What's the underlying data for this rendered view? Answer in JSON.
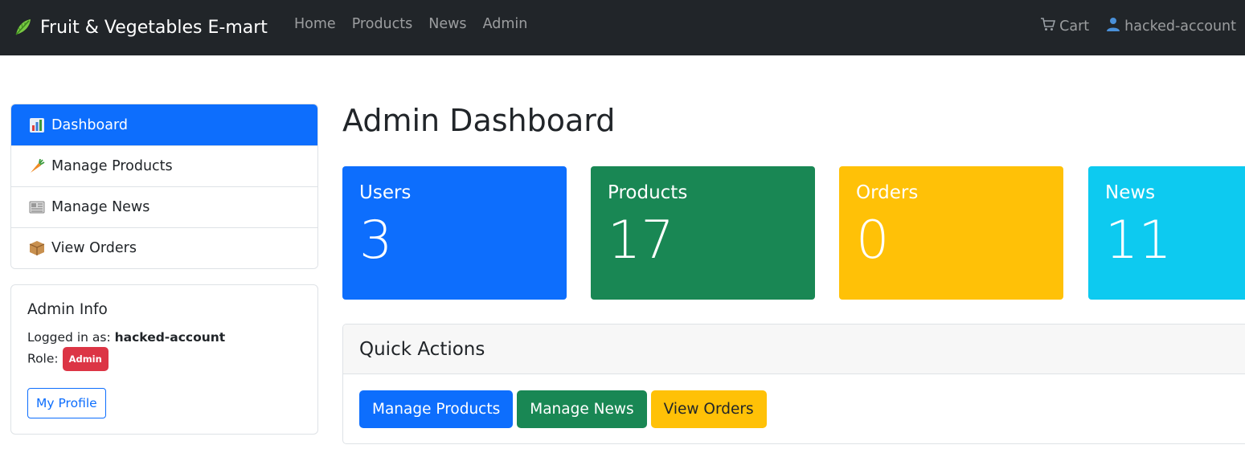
{
  "navbar": {
    "brand": "Fruit & Vegetables E-mart",
    "brand_icon": "lettuce-icon",
    "links": [
      "Home",
      "Products",
      "News",
      "Admin"
    ],
    "cart": "Cart",
    "user": "hacked-account"
  },
  "sidebar": {
    "items": [
      {
        "label": "Dashboard",
        "icon": "bar-chart-icon",
        "active": true
      },
      {
        "label": "Manage Products",
        "icon": "carrot-icon"
      },
      {
        "label": "Manage News",
        "icon": "newspaper-icon"
      },
      {
        "label": "View Orders",
        "icon": "package-icon"
      }
    ],
    "admin_info": {
      "title": "Admin Info",
      "logged_in_label": "Logged in as:",
      "username": "hacked-account",
      "role_label": "Role:",
      "role": "Admin",
      "profile_button": "My Profile"
    }
  },
  "main": {
    "title": "Admin Dashboard",
    "stats": [
      {
        "label": "Users",
        "value": "3",
        "color": "#0d6efd"
      },
      {
        "label": "Products",
        "value": "17",
        "color": "#198754"
      },
      {
        "label": "Orders",
        "value": "0",
        "color": "#ffc107"
      },
      {
        "label": "News",
        "value": "11",
        "color": "#0dcaf0"
      }
    ],
    "quick_actions": {
      "title": "Quick Actions",
      "buttons": [
        "Manage Products",
        "Manage News",
        "View Orders"
      ]
    }
  }
}
